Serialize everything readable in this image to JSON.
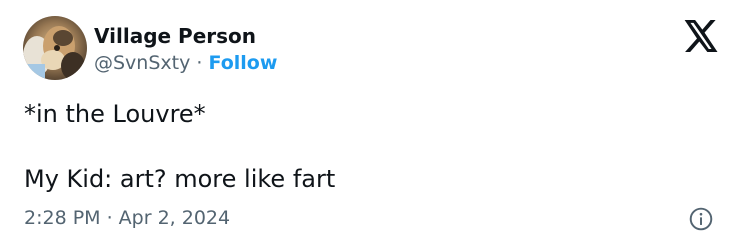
{
  "author": {
    "name": "Village Person",
    "handle": "@SvnSxty",
    "separator": "·",
    "follow_label": "Follow"
  },
  "tweet": {
    "line1": "*in the Louvre*",
    "line2": "My Kid: art? more like fart",
    "timestamp": "2:28 PM · Apr 2, 2024"
  },
  "icons": {
    "brand": "x-logo-icon",
    "info": "info-icon"
  },
  "colors": {
    "text": "#0f1419",
    "secondary": "#536471",
    "accent": "#1d9bf0"
  }
}
